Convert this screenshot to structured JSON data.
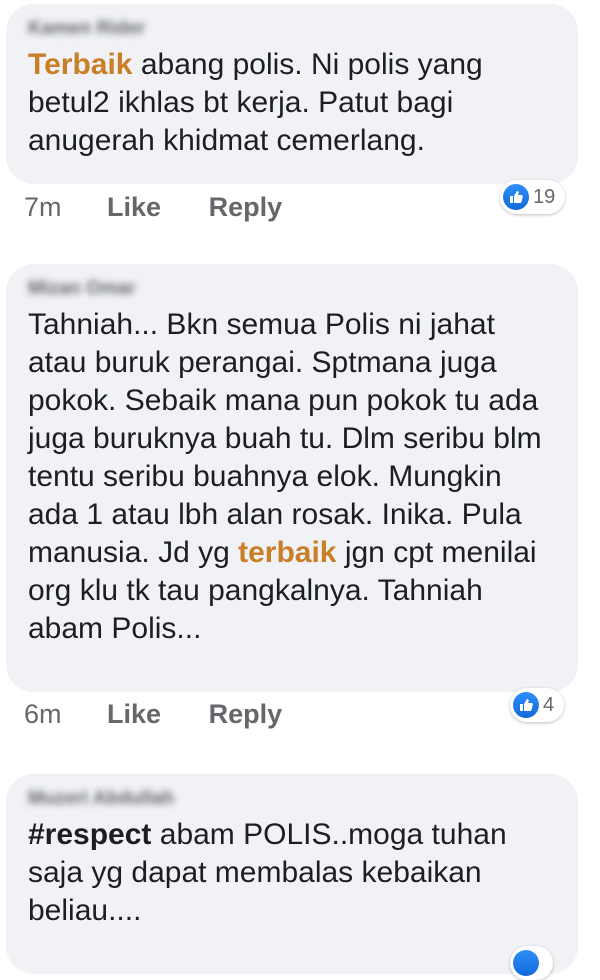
{
  "comments": [
    {
      "author": "Kamen Rider",
      "highlight": "Terbaik",
      "text_after": " abang polis. Ni polis yang betul2 ikhlas bt kerja. Patut bagi anugerah khidmat cemerlang.",
      "time": "7m",
      "like_label": "Like",
      "reply_label": "Reply",
      "reaction_count": "19"
    },
    {
      "author": "Mizan Omar",
      "text_before": "Tahniah... Bkn semua Polis ni jahat atau buruk perangai. Sptmana juga pokok. Sebaik mana pun pokok tu ada juga buruknya buah tu. Dlm seribu blm tentu seribu buahnya elok. Mungkin ada 1 atau lbh alan rosak. Inika. Pula manusia. Jd yg ",
      "highlight": "terbaik",
      "text_after": " jgn cpt menilai org klu tk tau pangkalnya. Tahniah abam Polis...",
      "time": "6m",
      "like_label": "Like",
      "reply_label": "Reply",
      "reaction_count": "4"
    },
    {
      "author": "Muzeri Abdullah",
      "hashtag": "#respect",
      "text_after": " abam POLIS..moga tuhan saja yg dapat membalas kebaikan beliau...."
    }
  ],
  "icons": {
    "reaction": "thumbs-up-icon"
  },
  "colors": {
    "highlight": "#c97e28",
    "bubble": "#f0f2f5",
    "meta": "#65676b",
    "reaction": "#1877f2"
  }
}
